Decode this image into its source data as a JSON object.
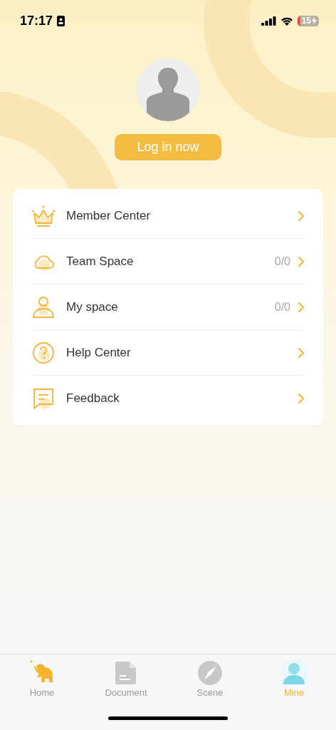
{
  "status_bar": {
    "time": "17:17",
    "battery": "15"
  },
  "profile": {
    "login_button": "Log in now"
  },
  "menu": [
    {
      "kind": "crown",
      "label": "Member Center"
    },
    {
      "kind": "cloud",
      "label": "Team Space",
      "count": "0/0"
    },
    {
      "kind": "person",
      "label": "My space",
      "count": "0/0"
    },
    {
      "kind": "help",
      "label": "Help Center"
    },
    {
      "kind": "feedback",
      "label": "Feedback"
    }
  ],
  "tab_bar": [
    {
      "kind": "home",
      "label": "Home",
      "selected": false
    },
    {
      "kind": "document",
      "label": "Document",
      "selected": false
    },
    {
      "kind": "scene",
      "label": "Scene",
      "selected": false
    },
    {
      "kind": "mine",
      "label": "Mine",
      "selected": true
    }
  ]
}
